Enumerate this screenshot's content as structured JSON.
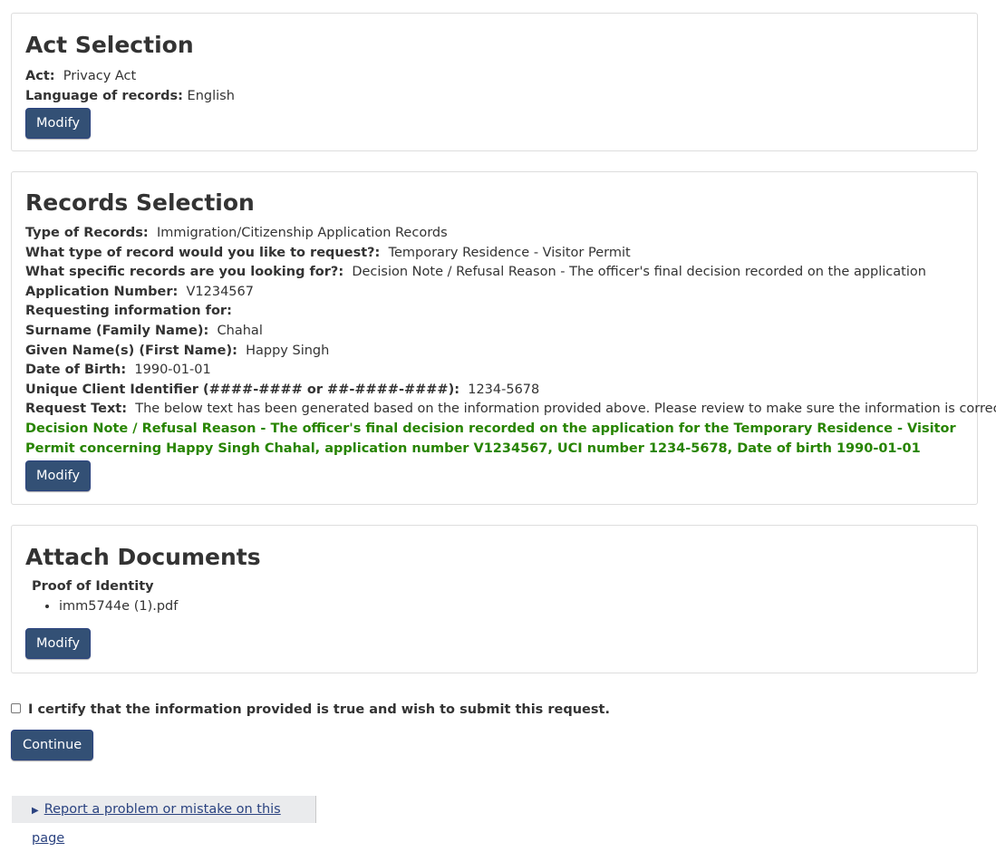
{
  "act_selection": {
    "title": "Act Selection",
    "act_label": "Act:",
    "act_value": "Privacy Act",
    "language_label": "Language of records:",
    "language_value": "English",
    "modify_label": "Modify"
  },
  "records_selection": {
    "title": "Records Selection",
    "rows": [
      {
        "label": "Type of Records:",
        "value": "Immigration/Citizenship Application Records"
      },
      {
        "label": "What type of record would you like to request?:",
        "value": "Temporary Residence - Visitor Permit"
      },
      {
        "label": "What specific records are you looking for?:",
        "value": "Decision Note / Refusal Reason - The officer's final decision recorded on the application"
      },
      {
        "label": "Application Number:",
        "value": "V1234567"
      },
      {
        "label": "Requesting information for:",
        "value": ""
      },
      {
        "label": "Surname (Family Name):",
        "value": "Chahal"
      },
      {
        "label": "Given Name(s) (First Name):",
        "value": "Happy Singh"
      },
      {
        "label": "Date of Birth:",
        "value": "1990-01-01"
      },
      {
        "label": "Unique Client Identifier (####-#### or ##-####-####):",
        "value": "1234-5678"
      },
      {
        "label": "Request Text:",
        "value": "The below text has been generated based on the information provided above. Please review to make sure the information is correct:"
      }
    ],
    "request_text": "Decision Note / Refusal Reason - The officer's final decision recorded on the application for the Temporary Residence - Visitor Permit concerning Happy Singh Chahal, application number V1234567, UCI number 1234-5678, Date of birth 1990-01-01",
    "modify_label": "Modify"
  },
  "attach_documents": {
    "title": "Attach Documents",
    "proof_heading": "Proof of Identity",
    "files": [
      "imm5744e (1).pdf"
    ],
    "modify_label": "Modify"
  },
  "certify": {
    "checked": false,
    "label": "I certify that the information provided is true and wish to submit this request."
  },
  "continue_label": "Continue",
  "report_problem": "Report a problem or mistake on this page"
}
